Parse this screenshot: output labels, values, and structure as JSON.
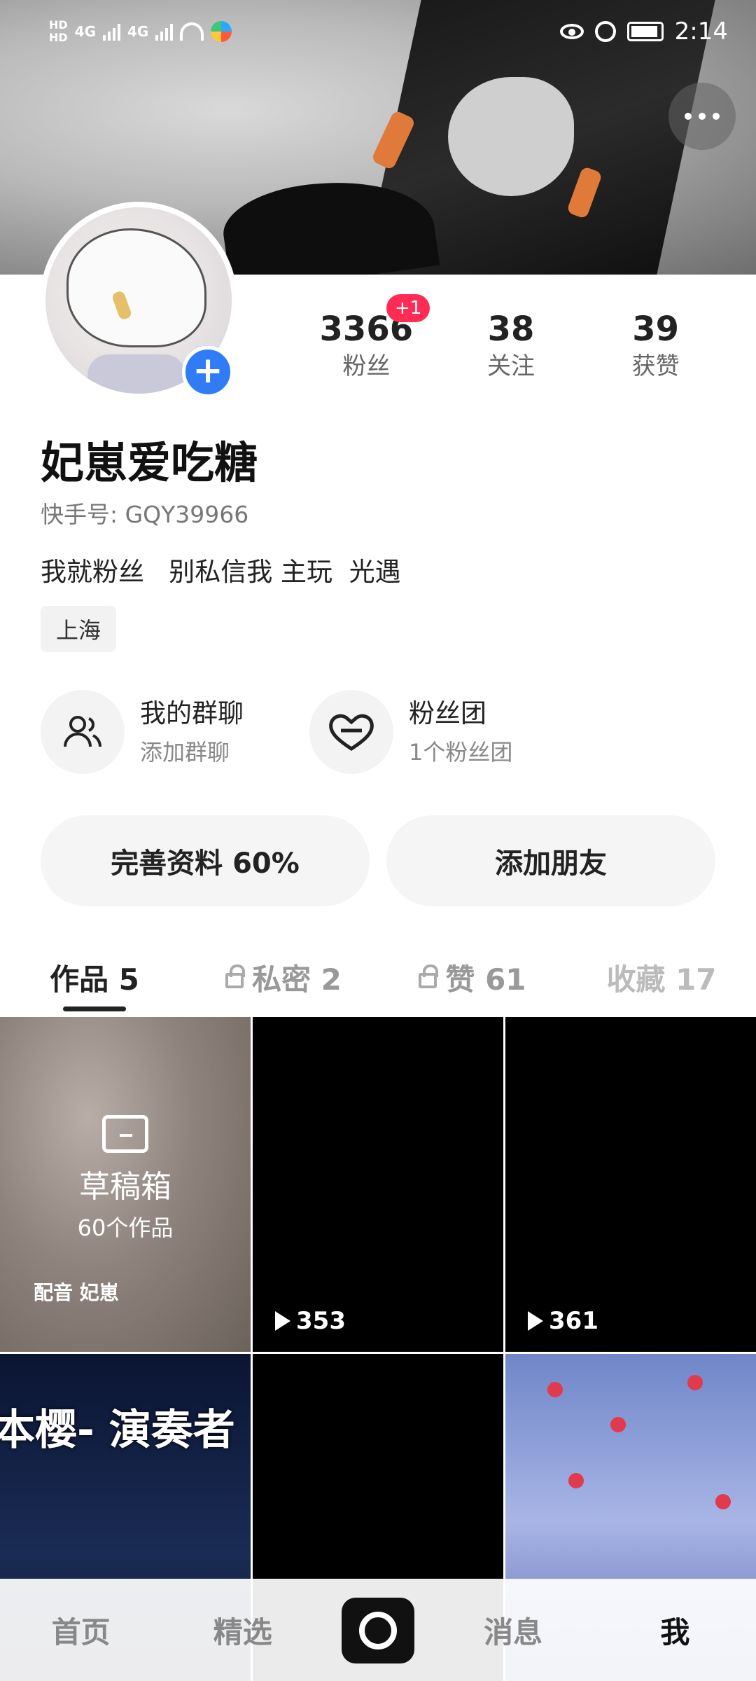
{
  "status_bar": {
    "time": "2:14",
    "signal_labels": [
      "HD",
      "4G",
      "4G"
    ]
  },
  "profile": {
    "name": "妃崽爱吃糖",
    "kuaishou_id": "快手号: GQY39966",
    "bio": "我就粉丝   别私信我 主玩  光遇",
    "location": "上海",
    "stats": [
      {
        "num": "3366",
        "label": "粉丝",
        "badge": "+1"
      },
      {
        "num": "38",
        "label": "关注"
      },
      {
        "num": "39",
        "label": "获赞"
      }
    ]
  },
  "cards": [
    {
      "title": "我的群聊",
      "sub": "添加群聊",
      "icon": "group-icon"
    },
    {
      "title": "粉丝团",
      "sub": "1个粉丝团",
      "icon": "heart-icon"
    }
  ],
  "buttons": {
    "complete_profile": "完善资料 60%",
    "add_friend": "添加朋友"
  },
  "tabs": [
    {
      "label": "作品 5",
      "locked": false
    },
    {
      "label": "私密 2",
      "locked": true
    },
    {
      "label": "赞 61",
      "locked": true
    },
    {
      "label": "收藏 17",
      "locked": false
    }
  ],
  "grid": {
    "draft": {
      "title": "草稿箱",
      "count": "60个作品",
      "tag": "配音  妃崽"
    },
    "items": [
      {
        "views": "353"
      },
      {
        "views": "361"
      },
      {
        "overlay": "本樱- 演奏者"
      }
    ]
  },
  "bottom_nav": [
    "首页",
    "精选",
    "消息",
    "我"
  ],
  "colors": {
    "accent_blue": "#2f7cf6",
    "badge_red": "#fe2c55"
  }
}
